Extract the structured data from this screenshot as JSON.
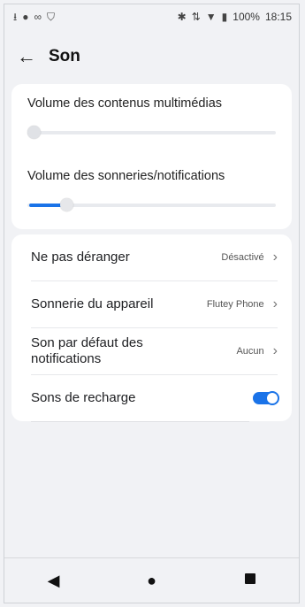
{
  "status_bar": {
    "left_icons": [
      "upload-icon",
      "android-icon",
      "link-icon",
      "shield-icon"
    ],
    "right_icons": [
      "bluetooth-icon",
      "data-arrows-icon",
      "wifi-icon",
      "battery-icon"
    ],
    "battery_label": "100%",
    "time": "18:15"
  },
  "app_bar": {
    "back_glyph": "←",
    "title": "Son"
  },
  "volumes": {
    "media_label": "Volume des contenus multimédias",
    "media_level": 0.0,
    "ringer_label": "Volume des sonneries/notifications",
    "ringer_level": 0.13
  },
  "settings": {
    "dnd_label": "Ne pas déranger",
    "dnd_value": "Désactivé",
    "ringtone_label": "Sonnerie du appareil",
    "ringtone_value": "Flutey Phone",
    "notif_label": "Son par défaut des notifications",
    "notif_value": "Aucun",
    "charging_label": "Sons de recharge",
    "charging_on": true
  },
  "navbar": {
    "back": "◀",
    "home": "●"
  },
  "colors": {
    "accent": "#1a73e8",
    "background": "#f1f2f5",
    "card": "#ffffff"
  }
}
